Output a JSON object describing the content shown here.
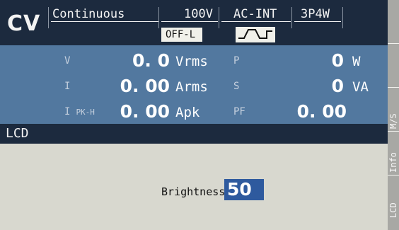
{
  "status_bar": {
    "mode": "CV",
    "trigger": "Continuous",
    "range": "100V",
    "source": "AC-INT",
    "wiring": "3P4W",
    "output_state": "OFF-L",
    "waveform_icon": "square-wave-icon"
  },
  "measurements": {
    "left": [
      {
        "label": "V",
        "label_sub": "",
        "value": "0. 0",
        "unit": "Vrms"
      },
      {
        "label": "I",
        "label_sub": "",
        "value": "0. 00",
        "unit": "Arms"
      },
      {
        "label": "I",
        "label_sub": "PK-H",
        "value": "0. 00",
        "unit": "Apk"
      }
    ],
    "right": [
      {
        "label": "P",
        "value": "0",
        "unit": "W"
      },
      {
        "label": "S",
        "value": "0",
        "unit": "VA"
      },
      {
        "label": "PF",
        "value": "0. 00",
        "unit": ""
      }
    ]
  },
  "panel": {
    "title": "LCD",
    "brightness_label": "Brightness",
    "brightness_value": "50"
  },
  "softkeys": [
    "M/S",
    "Info",
    "LCD"
  ],
  "colors": {
    "status_bg": "#1c2a3e",
    "measure_bg": "#52789f",
    "content_bg": "#d8d8cf",
    "value_highlight": "#2e5a9e"
  }
}
